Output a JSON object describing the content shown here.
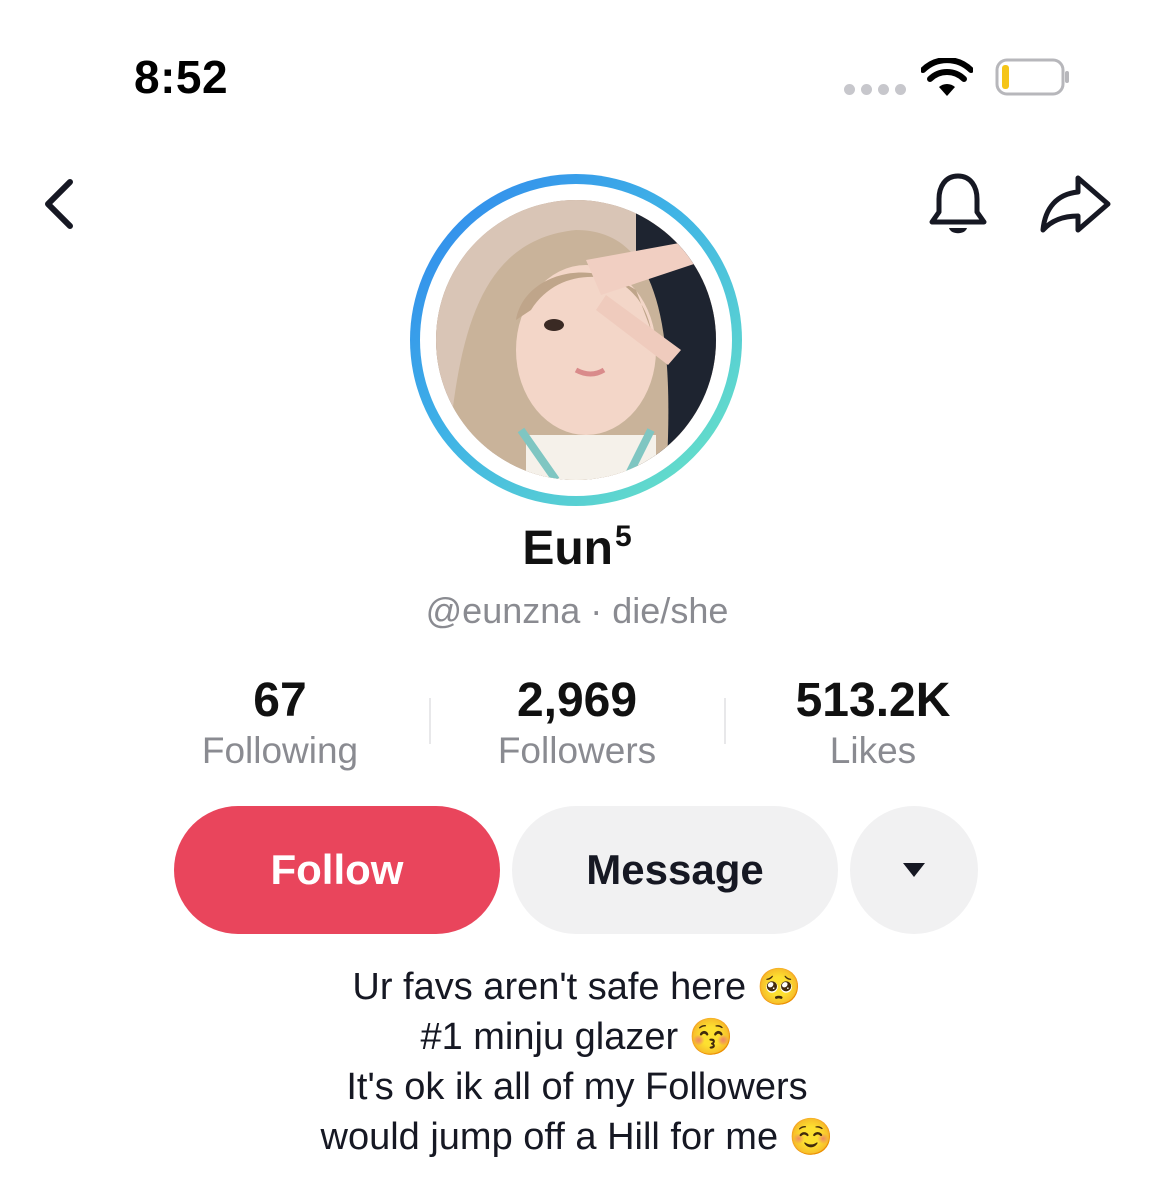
{
  "status_bar": {
    "time": "8:52"
  },
  "profile": {
    "display_name": "Eun",
    "display_name_superscript": "5",
    "handle_line": "@eunzna · die/she"
  },
  "stats": [
    {
      "value": "67",
      "label": "Following"
    },
    {
      "value": "2,969",
      "label": "Followers"
    },
    {
      "value": "513.2K",
      "label": "Likes"
    }
  ],
  "actions": {
    "follow": "Follow",
    "message": "Message"
  },
  "bio": {
    "line1": "Ur favs aren't safe here",
    "line1_emoji": "🥺",
    "line2": "#1 minju glazer",
    "line2_emoji": "😚",
    "line3": "It's ok ik all of my Followers",
    "line4": "would jump off a Hill for me",
    "line4_emoji": "☺️"
  },
  "colors": {
    "follow_button": "#e9455c",
    "secondary_button": "#f1f1f2",
    "avatar_ring_start": "#2f83ee",
    "avatar_ring_end": "#6ee9c2",
    "battery_low": "#f5c518"
  },
  "icons": [
    "back-chevron-icon",
    "bell-icon",
    "share-arrow-icon",
    "wifi-icon",
    "battery-icon",
    "caret-down-icon"
  ]
}
